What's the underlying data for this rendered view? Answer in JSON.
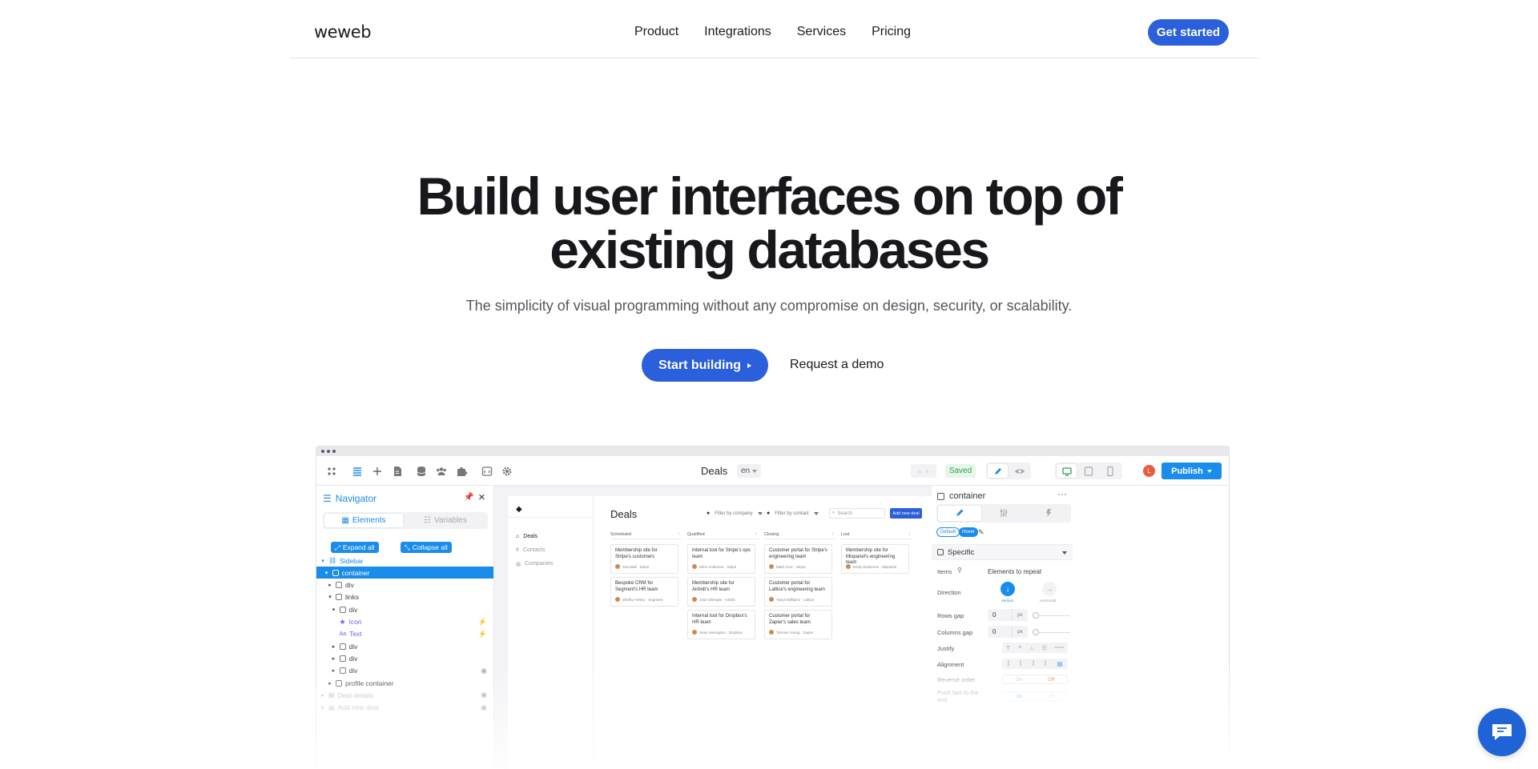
{
  "nav": {
    "logo": "weweb",
    "links": [
      "Product",
      "Integrations",
      "Services",
      "Pricing"
    ],
    "cta": "Get started"
  },
  "hero": {
    "title_line1": "Build user interfaces on top of",
    "title_line2": "existing databases",
    "subtitle": "The simplicity of visual programming without any compromise on design, security, or scalability.",
    "primary_cta": "Start building",
    "secondary_cta": "Request a demo"
  },
  "editor": {
    "page_name": "Deals",
    "lang": "en",
    "saved": "Saved",
    "avatar": "L",
    "publish": "Publish",
    "navigator": {
      "title": "Navigator",
      "tab_elements": "Elements",
      "tab_variables": "Variables",
      "expand_all": "Expand all",
      "collapse_all": "Collapse all",
      "tree": [
        {
          "label": "Sidebar",
          "indent": 0,
          "arrow": "▾",
          "style": "blue"
        },
        {
          "label": "container",
          "indent": 1,
          "arrow": "▾",
          "style": "sel"
        },
        {
          "label": "div",
          "indent": 2,
          "arrow": "▸",
          "style": ""
        },
        {
          "label": "links",
          "indent": 2,
          "arrow": "▾",
          "style": ""
        },
        {
          "label": "div",
          "indent": 3,
          "arrow": "▾",
          "style": ""
        },
        {
          "label": "Icon",
          "indent": 3,
          "arrow": "",
          "style": "icon"
        },
        {
          "label": "Text",
          "indent": 3,
          "arrow": "",
          "style": "text"
        },
        {
          "label": "div",
          "indent": 3,
          "arrow": "▸",
          "style": ""
        },
        {
          "label": "div",
          "indent": 3,
          "arrow": "▸",
          "style": ""
        },
        {
          "label": "div",
          "indent": 3,
          "arrow": "▸",
          "style": "eye"
        },
        {
          "label": "profile container",
          "indent": 2,
          "arrow": "▸",
          "style": ""
        },
        {
          "label": "Deal details",
          "indent": 0,
          "arrow": "▸",
          "style": "faded"
        },
        {
          "label": "Add new deal",
          "indent": 0,
          "arrow": "▸",
          "style": "faded"
        }
      ]
    },
    "app": {
      "logo": "◆",
      "nav": [
        "Deals",
        "Contacts",
        "Companies"
      ],
      "title": "Deals",
      "filter_company": "Filter by company",
      "filter_contact": "Filter by contact",
      "search_placeholder": "Search",
      "add_button": "Add new deal",
      "columns": [
        {
          "name": "Scheduled",
          "cards": [
            {
              "title": "Membership site for Stripe's customers",
              "who": "Tara Ball · Stripe"
            },
            {
              "title": "Bespoke CRM for Segment's HR team",
              "who": "Shelby Ashley · Segment"
            }
          ]
        },
        {
          "name": "Qualified",
          "cards": [
            {
              "title": "Internal tool for Stripe's ops team",
              "who": "Elton Anderson · Stripe"
            },
            {
              "title": "Membership site for Airbnb's HR team",
              "who": "Jose Gillespie · Airbnb"
            },
            {
              "title": "Internal tool for Dropbox's HR team",
              "who": "Sean Harrington · Dropbox"
            }
          ]
        },
        {
          "name": "Closing",
          "cards": [
            {
              "title": "Customer portal for Stripe's engineering team",
              "who": "Mark Cruz · Stripe"
            },
            {
              "title": "Customer portal for Lattice's engineering team",
              "who": "Tanya Williams · Lattice"
            },
            {
              "title": "Customer portal for Zapier's sales team",
              "who": "Tammie Young · Zapier"
            }
          ]
        },
        {
          "name": "Lost",
          "cards": [
            {
              "title": "Membership site for Mixpanel's engineering team",
              "who": "Emily Dickerson · Mixpanel"
            }
          ]
        }
      ]
    },
    "props": {
      "element": "container",
      "state_default": "Default",
      "state_hover": "Hover",
      "section": "Specific",
      "items_label": "Items",
      "items_value": "Elements to repeat",
      "direction_label": "Direction",
      "direction_vertical": "Vertical",
      "direction_horizontal": "Horizontal",
      "rows_gap_label": "Rows gap",
      "rows_gap": "0",
      "columns_gap_label": "Columns gap",
      "columns_gap": "0",
      "unit": "px",
      "justify_label": "Justify",
      "alignment_label": "Alignment",
      "reverse_label": "Reverse order",
      "push_label": "Push last to the end",
      "on": "On",
      "off": "Off"
    }
  },
  "colors": {
    "brand_blue": "#2b5fdb",
    "editor_blue": "#1a8ceb",
    "saved_green": "#2f9e56",
    "avatar_orange": "#ef5a3c"
  }
}
